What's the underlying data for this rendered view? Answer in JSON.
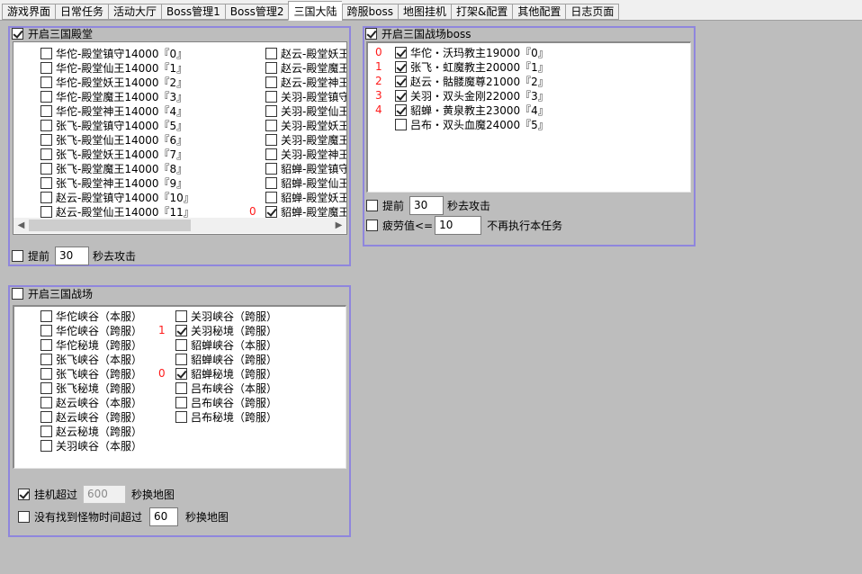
{
  "tabs": [
    "游戏界面",
    "日常任务",
    "活动大厅",
    "Boss管理1",
    "Boss管理2",
    "三国大陆",
    "跨服boss",
    "地图挂机",
    "打架&配置",
    "其他配置",
    "日志页面"
  ],
  "active_tab": "三国大陆",
  "hall": {
    "title": "开启三国殿堂",
    "title_checked": true,
    "col1": [
      "华佗-殿堂镇守14000『0』",
      "华佗-殿堂仙王14000『1』",
      "华佗-殿堂妖王14000『2』",
      "华佗-殿堂魔王14000『3』",
      "华佗-殿堂神王14000『4』",
      "张飞-殿堂镇守14000『5』",
      "张飞-殿堂仙王14000『6』",
      "张飞-殿堂妖王14000『7』",
      "张飞-殿堂魔王14000『8』",
      "张飞-殿堂神王14000『9』",
      "赵云-殿堂镇守14000『10』",
      "赵云-殿堂仙王14000『11』"
    ],
    "col2": [
      "赵云-殿堂妖王",
      "赵云-殿堂魔王",
      "赵云-殿堂神王",
      "关羽-殿堂镇守",
      "关羽-殿堂仙王",
      "关羽-殿堂妖王",
      "关羽-殿堂魔王",
      "关羽-殿堂神王",
      "貂蝉-殿堂镇守",
      "貂蝉-殿堂仙王",
      "貂蝉-殿堂妖王",
      "貂蝉-殿堂魔王"
    ],
    "col2_checked_index": 11,
    "col2_marker": "0",
    "advance_label": "提前",
    "advance_value": "30",
    "advance_suffix": "秒去攻击"
  },
  "battlefield": {
    "title": "开启三国战场",
    "title_checked": false,
    "col1": [
      "华佗峡谷（本服）",
      "华佗峡谷（跨服）",
      "华佗秘境（跨服）",
      "张飞峡谷（本服）",
      "张飞峡谷（跨服）",
      "张飞秘境（跨服）",
      "赵云峡谷（本服）",
      "赵云峡谷（跨服）",
      "赵云秘境（跨服）",
      "关羽峡谷（本服）"
    ],
    "col2": [
      "关羽峡谷（跨服）",
      "关羽秘境（跨服）",
      "貂蝉峡谷（本服）",
      "貂蝉峡谷（跨服）",
      "貂蝉秘境（跨服）",
      "吕布峡谷（本服）",
      "吕布峡谷（跨服）",
      "吕布秘境（跨服）"
    ],
    "col2_checked": [
      1,
      4
    ],
    "markers": [
      {
        "row": 1,
        "text": "1"
      },
      {
        "row": 4,
        "text": "0"
      }
    ],
    "afk_label": "挂机超过",
    "afk_checked": true,
    "afk_value": "600",
    "afk_suffix": "秒换地图",
    "nomonster_label": "没有找到怪物时间超过",
    "nomonster_checked": false,
    "nomonster_value": "60",
    "nomonster_suffix": "秒换地图"
  },
  "boss": {
    "title": "开启三国战场boss",
    "title_checked": true,
    "items": [
      {
        "marker": "0",
        "label": "华佗・沃玛教主19000『0』",
        "checked": true
      },
      {
        "marker": "1",
        "label": "张飞・虹魔教主20000『1』",
        "checked": true
      },
      {
        "marker": "2",
        "label": "赵云・骷髅魔尊21000『2』",
        "checked": true
      },
      {
        "marker": "3",
        "label": "关羽・双头金刚22000『3』",
        "checked": true
      },
      {
        "marker": "4",
        "label": "貂蝉・黄泉教主23000『4』",
        "checked": true
      },
      {
        "marker": "",
        "label": "吕布・双头血魔24000『5』",
        "checked": false
      }
    ],
    "advance_label": "提前",
    "advance_value": "30",
    "advance_suffix": "秒去攻击",
    "fatigue_label": "疲劳值<=",
    "fatigue_value": "10",
    "fatigue_suffix": "不再执行本任务"
  }
}
